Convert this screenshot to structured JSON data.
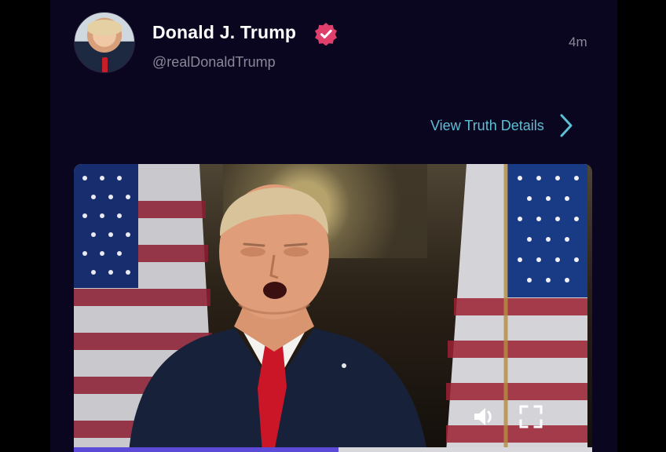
{
  "post": {
    "author_name": "Donald J. Trump",
    "handle": "@realDonaldTrump",
    "timestamp": "4m",
    "details_link": "View Truth Details"
  },
  "icons": {
    "verified": "verified-badge-icon",
    "chevron": "chevron-right-icon",
    "volume": "volume-icon",
    "fullscreen": "fullscreen-icon"
  },
  "colors": {
    "background": "#0b0620",
    "accent": "#5ebfd4",
    "verified": "#e03f6c",
    "progress": "#5b4bd6"
  },
  "video": {
    "progress": 0.51
  }
}
